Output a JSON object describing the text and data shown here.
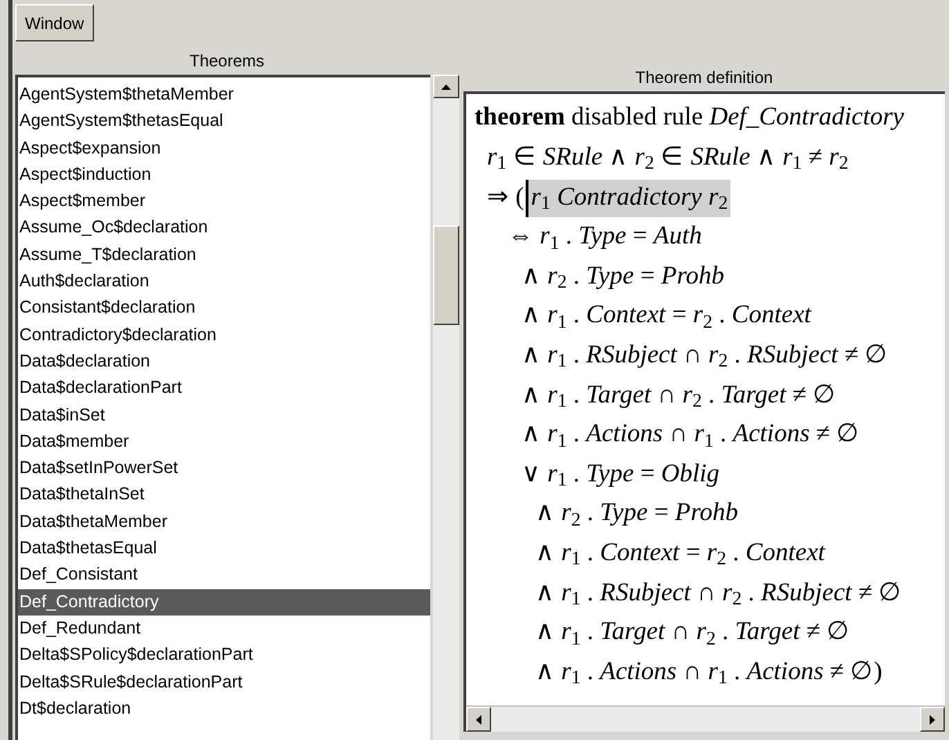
{
  "toolbar": {
    "buttons": [
      {
        "label": "Window"
      }
    ]
  },
  "theorems": {
    "title": "Theorems",
    "items": [
      {
        "label": "AgentSystem$thetaMember",
        "selected": false
      },
      {
        "label": "AgentSystem$thetasEqual",
        "selected": false
      },
      {
        "label": "Aspect$expansion",
        "selected": false
      },
      {
        "label": "Aspect$induction",
        "selected": false
      },
      {
        "label": "Aspect$member",
        "selected": false
      },
      {
        "label": "Assume_Oc$declaration",
        "selected": false
      },
      {
        "label": "Assume_T$declaration",
        "selected": false
      },
      {
        "label": "Auth$declaration",
        "selected": false
      },
      {
        "label": "Consistant$declaration",
        "selected": false
      },
      {
        "label": "Contradictory$declaration",
        "selected": false
      },
      {
        "label": "Data$declaration",
        "selected": false
      },
      {
        "label": "Data$declarationPart",
        "selected": false
      },
      {
        "label": "Data$inSet",
        "selected": false
      },
      {
        "label": "Data$member",
        "selected": false
      },
      {
        "label": "Data$setInPowerSet",
        "selected": false
      },
      {
        "label": "Data$thetaInSet",
        "selected": false
      },
      {
        "label": "Data$thetaMember",
        "selected": false
      },
      {
        "label": "Data$thetasEqual",
        "selected": false
      },
      {
        "label": "Def_Consistant",
        "selected": false
      },
      {
        "label": "Def_Contradictory",
        "selected": true
      },
      {
        "label": "Def_Redundant",
        "selected": false
      },
      {
        "label": "Delta$SPolicy$declarationPart",
        "selected": false
      },
      {
        "label": "Delta$SRule$declarationPart",
        "selected": false
      },
      {
        "label": "Dt$declaration",
        "selected": false
      }
    ]
  },
  "definition": {
    "title": "Theorem definition",
    "lines": [
      {
        "text": "**theorem** disabled rule *Def_Contradictory*",
        "children": [
          {
            "text": "*r*$_{1}$ ∈ *SRule* ∧ *r*$_{2}$ ∈ *SRule* ∧ *r*$_{1}$ ≠ *r*$_{2}$"
          },
          {
            "text": "⇒ (",
            "selection": "*r*$_{1}$ *Contradictory r*$_{2}$",
            "cursor": true,
            "children": [
              {
                "text": "⇔ *r*$_{1}$ . *Type* = *Auth*",
                "children": [
                  {
                    "text": "∧ *r*$_{2}$ . *Type* = *Prohb*"
                  },
                  {
                    "text": "∧ *r*$_{1}$ . *Context* = *r*$_{2}$ . *Context*"
                  },
                  {
                    "text": "∧ *r*$_{1}$ . *RSubject* ∩ *r*$_{2}$ . *RSubject* ≠ ∅"
                  },
                  {
                    "text": "∧ *r*$_{1}$ . *Target* ∩ *r*$_{2}$ . *Target* ≠ ∅"
                  },
                  {
                    "text": "∧ *r*$_{1}$ . *Actions* ∩ *r*$_{1}$ . *Actions* ≠ ∅"
                  },
                  {
                    "text": "∨ *r*$_{1}$ . *Type* = *Oblig*",
                    "children": [
                      {
                        "text": "∧ *r*$_{2}$ . *Type* = *Prohb*"
                      },
                      {
                        "text": "∧ *r*$_{1}$ . *Context* = *r*$_{2}$ . *Context*"
                      },
                      {
                        "text": "∧ *r*$_{1}$ . *RSubject* ∩ *r*$_{2}$ . *RSubject* ≠ ∅"
                      },
                      {
                        "text": "∧ *r*$_{1}$ . *Target* ∩ *r*$_{2}$ . *Target* ≠ ∅"
                      },
                      {
                        "text": "∧ *r*$_{1}$ . *Actions* ∩ *r*$_{1}$ . *Actions* ≠ ∅)"
                      }
                    ]
                  }
                ]
              }
            ]
          }
        ]
      }
    ]
  }
}
